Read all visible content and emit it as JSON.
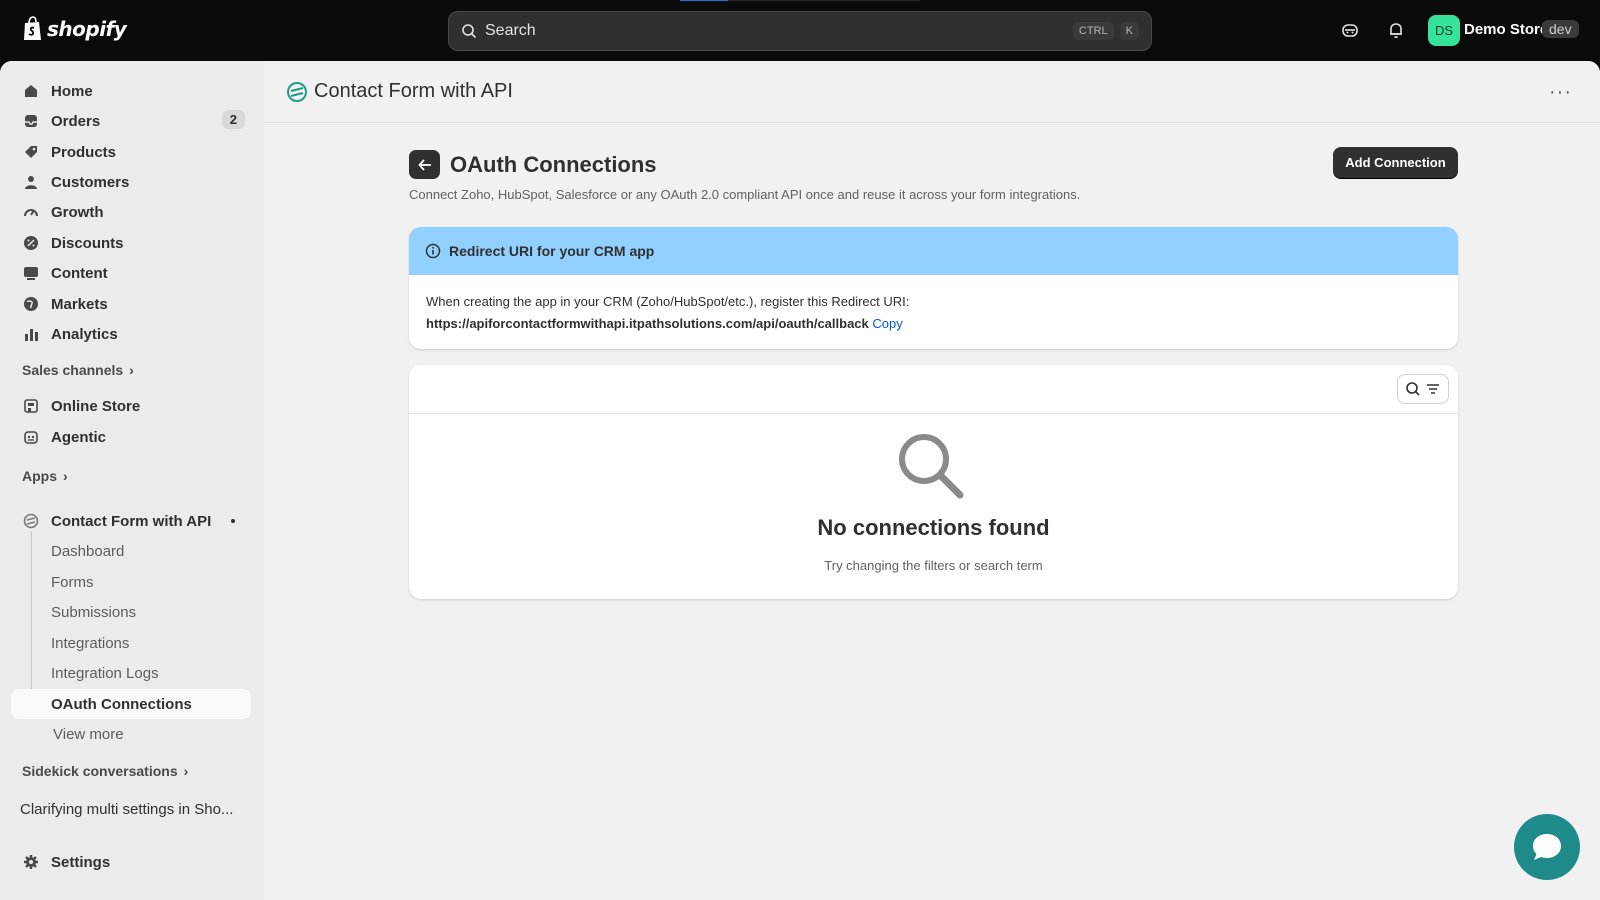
{
  "topbar": {
    "brand": "shopify",
    "search_placeholder": "Search",
    "shortcut_ctrl": "CTRL",
    "shortcut_key": "K",
    "avatar_initials": "DS",
    "store_name": "Demo Store",
    "store_tag": "dev"
  },
  "sidebar": {
    "items": [
      {
        "label": "Home",
        "icon": "home-icon"
      },
      {
        "label": "Orders",
        "icon": "inbox-icon",
        "badge": "2"
      },
      {
        "label": "Products",
        "icon": "tag-icon"
      },
      {
        "label": "Customers",
        "icon": "person-icon"
      },
      {
        "label": "Growth",
        "icon": "gauge-icon"
      },
      {
        "label": "Discounts",
        "icon": "discount-icon"
      },
      {
        "label": "Content",
        "icon": "content-icon"
      },
      {
        "label": "Markets",
        "icon": "globe-icon"
      },
      {
        "label": "Analytics",
        "icon": "bar-chart-icon"
      }
    ],
    "sales_channels_label": "Sales channels",
    "channels": [
      {
        "label": "Online Store",
        "icon": "store-icon"
      },
      {
        "label": "Agentic",
        "icon": "robot-icon"
      }
    ],
    "apps_label": "Apps",
    "app": {
      "label": "Contact Form with API",
      "subitems": [
        "Dashboard",
        "Forms",
        "Submissions",
        "Integrations",
        "Integration Logs",
        "OAuth Connections"
      ],
      "active": "OAuth Connections",
      "view_more": "View more"
    },
    "sidekick_label": "Sidekick conversations",
    "sidekick_item": "Clarifying multi settings in Sho...",
    "settings_label": "Settings"
  },
  "app_header": {
    "title": "Contact Form with API",
    "more": "···"
  },
  "page": {
    "title": "OAuth Connections",
    "subtitle": "Connect Zoho, HubSpot, Salesforce or any OAuth 2.0 compliant API once and reuse it across your form integrations.",
    "add_button": "Add Connection"
  },
  "banner": {
    "title": "Redirect URI for your CRM app",
    "body": "When creating the app in your CRM (Zoho/HubSpot/etc.), register this Redirect URI:",
    "uri": "https://apiforcontactformwithapi.itpathsolutions.com/api/oauth/callback",
    "copy": "Copy"
  },
  "empty_state": {
    "title": "No connections found",
    "subtitle": "Try changing the filters or search term"
  },
  "colors": {
    "banner_bg": "#91d0ff",
    "avatar_bg": "#36e39a",
    "chat_bg": "#1f8a8a",
    "link": "#005bd3"
  }
}
